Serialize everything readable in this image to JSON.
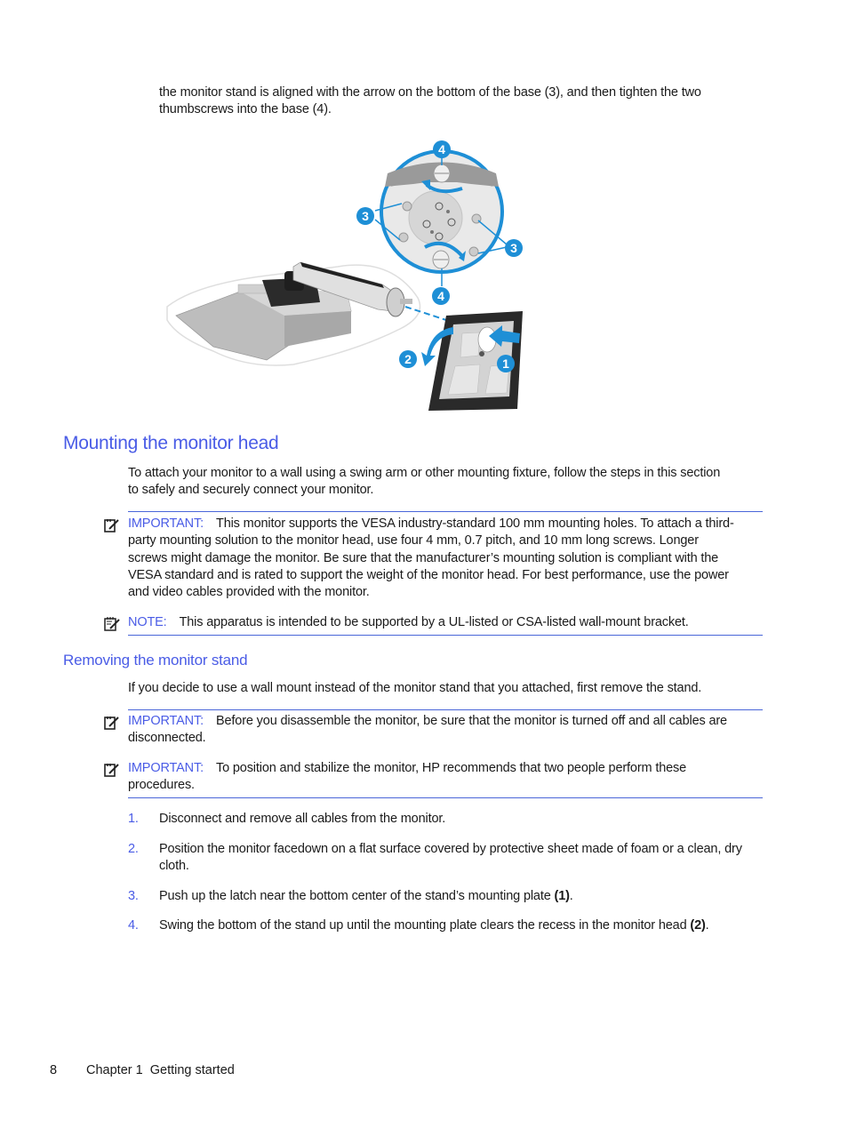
{
  "intro_paragraph": {
    "line1": "the monitor stand is aligned with the arrow on the bottom of the base (3), and then tighten the two",
    "line2": "thumbscrews into the base (4)."
  },
  "figure": {
    "description": "Illustration of attaching/removing the monitor stand with circular inset of base thumbscrews",
    "callouts": [
      "4",
      "3",
      "3",
      "4",
      "2",
      "1"
    ],
    "colors": {
      "callout": "#1e8fd6",
      "stand": "#c8c8c8",
      "dark": "#2a2a2a"
    }
  },
  "section_mounting": {
    "heading": "Mounting the monitor head",
    "paragraph": {
      "line1": "To attach your monitor to a wall using a swing arm or other mounting fixture, follow the steps in this section",
      "line2": "to safely and securely connect your monitor."
    },
    "important": {
      "label": "IMPORTANT:",
      "line1": "This monitor supports the VESA industry-standard 100 mm mounting holes. To attach a third-",
      "line2": "party mounting solution to the monitor head, use four 4 mm, 0.7 pitch, and 10 mm long screws. Longer",
      "line3": "screws might damage the monitor. Be sure that the manufacturer’s mounting solution is compliant with the",
      "line4": "VESA standard and is rated to support the weight of the monitor head. For best performance, use the power",
      "line5": "and video cables provided with the monitor."
    },
    "note": {
      "label": "NOTE:",
      "text": "This apparatus is intended to be supported by a UL-listed or CSA-listed wall-mount bracket."
    }
  },
  "section_removing": {
    "heading": "Removing the monitor stand",
    "paragraph": "If you decide to use a wall mount instead of the monitor stand that you attached, first remove the stand.",
    "important1": {
      "label": "IMPORTANT:",
      "line1": "Before you disassemble the monitor, be sure that the monitor is turned off and all cables are",
      "line2": "disconnected."
    },
    "important2": {
      "label": "IMPORTANT:",
      "line1": "To position and stabilize the monitor, HP recommends that two people perform these",
      "line2": "procedures."
    },
    "steps": [
      {
        "num": "1.",
        "line1": "Disconnect and remove all cables from the monitor."
      },
      {
        "num": "2.",
        "line1": "Position the monitor facedown on a flat surface covered by protective sheet made of foam or a clean, dry",
        "line2": "cloth."
      },
      {
        "num": "3.",
        "line1": "Push up the latch near the bottom center of the stand’s mounting plate ",
        "ref": "(1)",
        "tail": "."
      },
      {
        "num": "4.",
        "line1": "Swing the bottom of the stand up until the mounting plate clears the recess in the monitor head ",
        "ref": "(2)",
        "tail": "."
      }
    ]
  },
  "footer": {
    "page_number": "8",
    "chapter": "Chapter 1  Getting started"
  }
}
